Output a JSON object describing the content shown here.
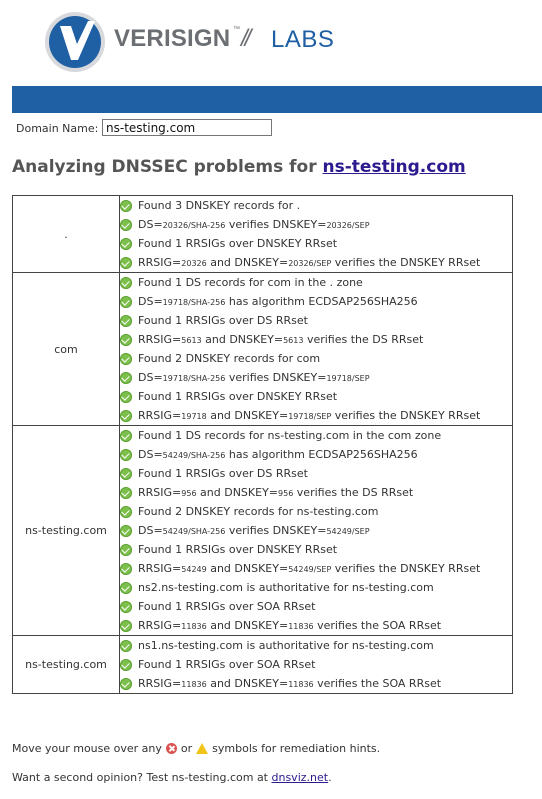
{
  "header": {
    "brand": "VERISIGN",
    "tm": "™",
    "slash": "//",
    "labs": "LABS"
  },
  "domain_field": {
    "label": "Domain Name:",
    "value": "ns-testing.com"
  },
  "title": {
    "prefix": "Analyzing DNSSEC problems for",
    "domain": "ns-testing.com"
  },
  "zones": [
    {
      "name": ".",
      "checks": [
        {
          "status": "ok",
          "parts": [
            {
              "t": "Found 3 DNSKEY records for ."
            }
          ]
        },
        {
          "status": "ok",
          "parts": [
            {
              "t": "DS="
            },
            {
              "t": "20326/SHA-256",
              "sm": true
            },
            {
              "t": " verifies DNSKEY="
            },
            {
              "t": "20326/SEP",
              "sm": true
            }
          ]
        },
        {
          "status": "ok",
          "parts": [
            {
              "t": "Found 1 RRSIGs over DNSKEY RRset"
            }
          ]
        },
        {
          "status": "ok",
          "parts": [
            {
              "t": "RRSIG="
            },
            {
              "t": "20326",
              "sm": true
            },
            {
              "t": " and DNSKEY="
            },
            {
              "t": "20326/SEP",
              "sm": true
            },
            {
              "t": " verifies the DNSKEY RRset"
            }
          ]
        }
      ]
    },
    {
      "name": "com",
      "checks": [
        {
          "status": "ok",
          "parts": [
            {
              "t": "Found 1 DS records for com in the . zone"
            }
          ]
        },
        {
          "status": "ok",
          "parts": [
            {
              "t": "DS="
            },
            {
              "t": "19718/SHA-256",
              "sm": true
            },
            {
              "t": " has algorithm ECDSAP256SHA256"
            }
          ]
        },
        {
          "status": "ok",
          "parts": [
            {
              "t": "Found 1 RRSIGs over DS RRset"
            }
          ]
        },
        {
          "status": "ok",
          "parts": [
            {
              "t": "RRSIG="
            },
            {
              "t": "5613",
              "sm": true
            },
            {
              "t": " and DNSKEY="
            },
            {
              "t": "5613",
              "sm": true
            },
            {
              "t": " verifies the DS RRset"
            }
          ]
        },
        {
          "status": "ok",
          "parts": [
            {
              "t": "Found 2 DNSKEY records for com"
            }
          ]
        },
        {
          "status": "ok",
          "parts": [
            {
              "t": "DS="
            },
            {
              "t": "19718/SHA-256",
              "sm": true
            },
            {
              "t": " verifies DNSKEY="
            },
            {
              "t": "19718/SEP",
              "sm": true
            }
          ]
        },
        {
          "status": "ok",
          "parts": [
            {
              "t": "Found 1 RRSIGs over DNSKEY RRset"
            }
          ]
        },
        {
          "status": "ok",
          "parts": [
            {
              "t": "RRSIG="
            },
            {
              "t": "19718",
              "sm": true
            },
            {
              "t": " and DNSKEY="
            },
            {
              "t": "19718/SEP",
              "sm": true
            },
            {
              "t": " verifies the DNSKEY RRset"
            }
          ]
        }
      ]
    },
    {
      "name": "ns-testing.com",
      "checks": [
        {
          "status": "ok",
          "parts": [
            {
              "t": "Found 1 DS records for ns-testing.com in the com zone"
            }
          ]
        },
        {
          "status": "ok",
          "parts": [
            {
              "t": "DS="
            },
            {
              "t": "54249/SHA-256",
              "sm": true
            },
            {
              "t": " has algorithm ECDSAP256SHA256"
            }
          ]
        },
        {
          "status": "ok",
          "parts": [
            {
              "t": "Found 1 RRSIGs over DS RRset"
            }
          ]
        },
        {
          "status": "ok",
          "parts": [
            {
              "t": "RRSIG="
            },
            {
              "t": "956",
              "sm": true
            },
            {
              "t": " and DNSKEY="
            },
            {
              "t": "956",
              "sm": true
            },
            {
              "t": " verifies the DS RRset"
            }
          ]
        },
        {
          "status": "ok",
          "parts": [
            {
              "t": "Found 2 DNSKEY records for ns-testing.com"
            }
          ]
        },
        {
          "status": "ok",
          "parts": [
            {
              "t": "DS="
            },
            {
              "t": "54249/SHA-256",
              "sm": true
            },
            {
              "t": " verifies DNSKEY="
            },
            {
              "t": "54249/SEP",
              "sm": true
            }
          ]
        },
        {
          "status": "ok",
          "parts": [
            {
              "t": "Found 1 RRSIGs over DNSKEY RRset"
            }
          ]
        },
        {
          "status": "ok",
          "parts": [
            {
              "t": "RRSIG="
            },
            {
              "t": "54249",
              "sm": true
            },
            {
              "t": " and DNSKEY="
            },
            {
              "t": "54249/SEP",
              "sm": true
            },
            {
              "t": " verifies the DNSKEY RRset"
            }
          ]
        },
        {
          "status": "ok",
          "parts": [
            {
              "t": "ns2.ns-testing.com is authoritative for ns-testing.com"
            }
          ]
        },
        {
          "status": "ok",
          "parts": [
            {
              "t": "Found 1 RRSIGs over SOA RRset"
            }
          ]
        },
        {
          "status": "ok",
          "parts": [
            {
              "t": "RRSIG="
            },
            {
              "t": "11836",
              "sm": true
            },
            {
              "t": " and DNSKEY="
            },
            {
              "t": "11836",
              "sm": true
            },
            {
              "t": " verifies the SOA RRset"
            }
          ]
        }
      ]
    },
    {
      "name": "ns-testing.com",
      "checks": [
        {
          "status": "ok",
          "parts": [
            {
              "t": "ns1.ns-testing.com is authoritative for ns-testing.com"
            }
          ]
        },
        {
          "status": "ok",
          "parts": [
            {
              "t": "Found 1 RRSIGs over SOA RRset"
            }
          ]
        },
        {
          "status": "ok",
          "parts": [
            {
              "t": "RRSIG="
            },
            {
              "t": "11836",
              "sm": true
            },
            {
              "t": " and DNSKEY="
            },
            {
              "t": "11836",
              "sm": true
            },
            {
              "t": " verifies the SOA RRset"
            }
          ]
        }
      ]
    }
  ],
  "footer": {
    "hint_before": "Move your mouse over any",
    "hint_or": "or",
    "hint_after": "symbols for remediation hints.",
    "second_before": "Want a second opinion? Test ns-testing.com at",
    "second_link": "dnsviz.net",
    "second_after": "."
  },
  "icons": {
    "ok": "check-circle-icon",
    "error": "error-circle-icon",
    "warning": "warning-triangle-icon"
  },
  "colors": {
    "brand_blue": "#1f5fa4",
    "ok_green": "#7cc04b",
    "link": "#2b1b8f"
  }
}
